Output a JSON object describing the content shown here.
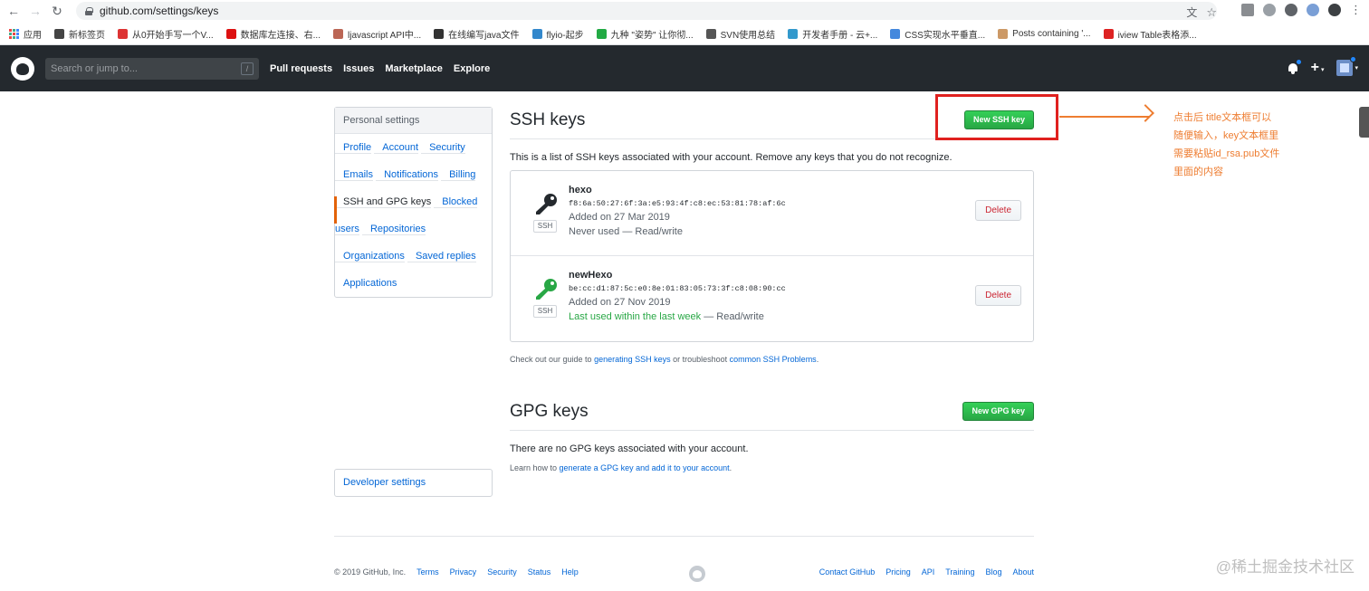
{
  "browser": {
    "url": "github.com/settings/keys",
    "bookmarks": [
      {
        "label": "应用",
        "color": "#e44"
      },
      {
        "label": "新标签页",
        "color": "#444"
      },
      {
        "label": "从0开始手写一个V...",
        "color": "#d33"
      },
      {
        "label": "数据库左连接、右...",
        "color": "#d11"
      },
      {
        "label": "ljavascript API中...",
        "color": "#b65"
      },
      {
        "label": "在线编写java文件",
        "color": "#333"
      },
      {
        "label": "flyio-起步",
        "color": "#38c"
      },
      {
        "label": "九种 \"姿势\" 让你彻...",
        "color": "#2a4"
      },
      {
        "label": "SVN使用总结",
        "color": "#555"
      },
      {
        "label": "开发者手册 - 云+...",
        "color": "#39c"
      },
      {
        "label": "CSS实现水平垂直...",
        "color": "#48d"
      },
      {
        "label": "Posts containing '...",
        "color": "#c96"
      },
      {
        "label": "iview Table表格添...",
        "color": "#d22"
      }
    ]
  },
  "header": {
    "search_placeholder": "Search or jump to...",
    "slash": "/",
    "nav": [
      "Pull requests",
      "Issues",
      "Marketplace",
      "Explore"
    ],
    "plus": "+",
    "caret": "▾"
  },
  "sidebar": {
    "title": "Personal settings",
    "items": [
      {
        "label": "Profile"
      },
      {
        "label": "Account"
      },
      {
        "label": "Security"
      },
      {
        "label": "Emails"
      },
      {
        "label": "Notifications"
      },
      {
        "label": "Billing"
      },
      {
        "label": "SSH and GPG keys"
      },
      {
        "label": "Blocked users"
      },
      {
        "label": "Repositories"
      },
      {
        "label": "Organizations"
      },
      {
        "label": "Saved replies"
      },
      {
        "label": "Applications"
      }
    ],
    "selected": "SSH and GPG keys",
    "developer": "Developer settings"
  },
  "ssh": {
    "title": "SSH keys",
    "new_button": "New SSH key",
    "intro": "This is a list of SSH keys associated with your account. Remove any keys that you do not recognize.",
    "keys": [
      {
        "name": "hexo",
        "fingerprint": "f8:6a:50:27:6f:3a:e5:93:4f:c8:ec:53:81:78:af:6c",
        "added": "Added on 27 Mar 2019",
        "usage": "Never used",
        "access": " — Read/write",
        "icon_color": "#24292e",
        "badge": "SSH",
        "delete": "Delete"
      },
      {
        "name": "newHexo",
        "fingerprint": "be:cc:d1:87:5c:e0:8e:01:83:05:73:3f:c8:08:90:cc",
        "added": "Added on 27 Nov 2019",
        "usage": "Last used within the last week",
        "access": " — Read/write",
        "icon_color": "#28a745",
        "badge": "SSH",
        "delete": "Delete"
      }
    ],
    "guide_prefix": "Check out our guide to ",
    "guide_link1": "generating SSH keys",
    "guide_mid": " or troubleshoot ",
    "guide_link2": "common SSH Problems",
    "guide_suffix": "."
  },
  "gpg": {
    "title": "GPG keys",
    "new_button": "New GPG key",
    "empty": "There are no GPG keys associated with your account.",
    "learn_prefix": "Learn how to ",
    "learn_link": "generate a GPG key and add it to your account",
    "learn_suffix": "."
  },
  "footer": {
    "copyright": "© 2019 GitHub, Inc.",
    "left_links": [
      "Terms",
      "Privacy",
      "Security",
      "Status",
      "Help"
    ],
    "right_links": [
      "Contact GitHub",
      "Pricing",
      "API",
      "Training",
      "Blog",
      "About"
    ]
  },
  "annotation": {
    "note": "点击后 title文本框可以随便输入，key文本框里需要粘贴id_rsa.pub文件里面的内容",
    "watermark": "@稀土掘金技术社区",
    "color": "#ee7d31"
  }
}
